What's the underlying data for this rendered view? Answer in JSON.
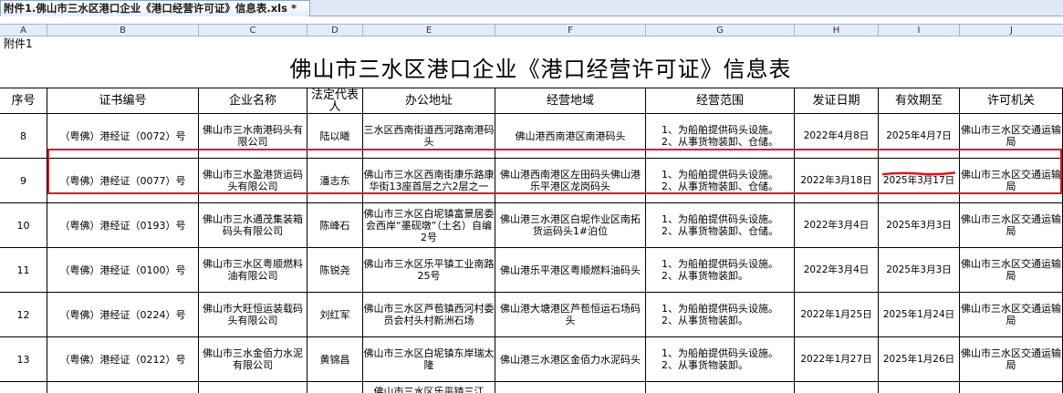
{
  "window": {
    "tab_title": "附件1.佛山市三水区港口企业《港口经营许可证》信息表.xls *"
  },
  "columns": [
    "A",
    "B",
    "C",
    "D",
    "E",
    "F",
    "G",
    "H",
    "I",
    "J"
  ],
  "sheet": {
    "annex_label": "附件1",
    "title": "佛山市三水区港口企业《港口经营许可证》信息表",
    "headers": [
      "序号",
      "证书编号",
      "企业名称",
      "法定代表人",
      "办公地址",
      "经营地域",
      "经营范围",
      "发证日期",
      "有效期至",
      "许可机关"
    ],
    "rows": [
      {
        "no": "8",
        "cert": "（粤佛）港经证（0072）号",
        "company": "佛山市三水南港码头有限公司",
        "rep": "陆以曦",
        "address": "三水区西南街道西河路南港码头",
        "area": "佛山港西南港区南港码头",
        "scope1": "1、为船舶提供码头设施。",
        "scope2": "2、从事货物装卸、仓储。",
        "issued": "2022年4月8日",
        "expires": "2025年4月7日",
        "authority": "佛山市三水区交通运输局"
      },
      {
        "no": "9",
        "cert": "（粤佛）港经证（0077）号",
        "company": "佛山市三水盈港货运码头有限公司",
        "rep": "潘志东",
        "address": "佛山市三水区西南街康乐路康华街13座首层之六2层之一",
        "area": "佛山港西南港区左田码头佛山港乐平港区龙岗码头",
        "scope1": "1、为船舶提供码头设施。",
        "scope2": "2、从事货物装卸、仓储。",
        "issued": "2022年3月18日",
        "expires": "2025年3月17日",
        "authority": "佛山市三水区交通运输局"
      },
      {
        "no": "10",
        "cert": "（粤佛）港经证（0193）号",
        "company": "佛山市三水通茂集装箱码头有限公司",
        "rep": "陈峰石",
        "address": "佛山市三水区白坭镇富景居委会西岸“墨砚墩”（土名）自编2号",
        "area": "佛山港三水港区白坭作业区南拓货运码头1#泊位",
        "scope1": "1、为船舶提供码头设施。",
        "scope2": "2、从事货物装卸、仓储。",
        "issued": "2022年3月4日",
        "expires": "2025年3月3日",
        "authority": "佛山市三水区交通运输局"
      },
      {
        "no": "11",
        "cert": "（粤佛）港经证（0100）号",
        "company": "佛山市三水区粤顺燃料油有限公司",
        "rep": "陈锐尧",
        "address": "佛山市三水区乐平镇工业南路25号",
        "area": "佛山港乐平港区粤顺燃料油码头",
        "scope1": "1、为船舶提供码头设施。",
        "scope2": "2、从事货物装卸。",
        "issued": "2022年3月4日",
        "expires": "2025年3月3日",
        "authority": "佛山市三水区交通运输局"
      },
      {
        "no": "12",
        "cert": "（粤佛）港经证（0224）号",
        "company": "佛山市大旺恒运装载码头有限公司",
        "rep": "刘红军",
        "address": "佛山市三水区芦苞镇西河村委员会村头村新洲石场",
        "area": "佛山港大塘港区芦苞恒运石场码头",
        "scope1": "1、为船舶提供码头设施。",
        "scope2": "2、从事货物装卸。",
        "issued": "2022年1月25日",
        "expires": "2025年1月24日",
        "authority": "佛山市三水区交通运输局"
      },
      {
        "no": "13",
        "cert": "（粤佛）港经证（0212）号",
        "company": "佛山市三水金佰力水泥有限公司",
        "rep": "黄锦昌",
        "address": "佛山市三水区白坭镇东岸瑞太隆",
        "area": "佛山港三水港区金佰力水泥码头",
        "scope1": "1、为船舶提供码头设施。",
        "scope2": "2、从事货物装卸。",
        "issued": "2022年1月27日",
        "expires": "2025年1月26日",
        "authority": "佛山市三水区交通运输局"
      }
    ],
    "partial_row": {
      "address": "佛山市三水区乐平镇三江"
    }
  },
  "colors": {
    "highlight": "#e0141e",
    "header_bg": "#e4ecf7",
    "tab_bg": "#dfe9f5"
  }
}
